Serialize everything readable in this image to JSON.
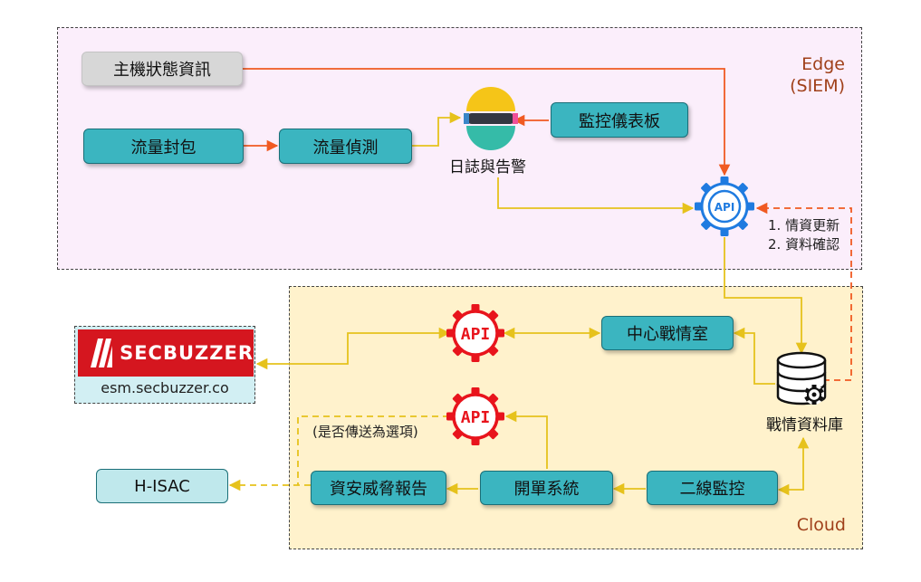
{
  "regions": {
    "edge": {
      "label_line1": "Edge",
      "label_line2": "(SIEM)"
    },
    "cloud": {
      "label": "Cloud"
    }
  },
  "nodes": {
    "host_status": "主機狀態資訊",
    "packet_capture": "流量封包",
    "traffic_detection": "流量偵測",
    "logs_alerts": "日誌與告警",
    "monitor_dashboard": "監控儀表板",
    "soc_center": "中心戰情室",
    "intel_db": "戰情資料庫",
    "tier2_monitoring": "二線監控",
    "ticket_system": "開單系統",
    "threat_report": "資安威脅報告",
    "h_isac": "H-ISAC",
    "secbuzzer_word": "SECBUZZER",
    "secbuzzer_url": "esm.secbuzzer.co"
  },
  "api": {
    "edge_api": "API",
    "cloud_api_1": "API",
    "cloud_api_2": "API"
  },
  "annotations": {
    "sync_step1": "1. 情資更新",
    "sync_step2": "2. 資料確認",
    "optional_send": "(是否傳送為選項)"
  },
  "icons": {
    "elastic": "elastic-logo-icon",
    "api_gear": "api-gear-icon",
    "database": "database-gear-icon",
    "secbuzzer": "secbuzzer-slash-logo-icon"
  },
  "colors": {
    "teal": "#3bb5c0",
    "edge_bg": "#fbeefb",
    "cloud_bg": "#fff2cc",
    "orange_arrow": "#f05a22",
    "yellow_arrow": "#e6c21c",
    "api_blue": "#1f7be0",
    "api_red": "#e8141c",
    "brand_red": "#d5161f"
  }
}
